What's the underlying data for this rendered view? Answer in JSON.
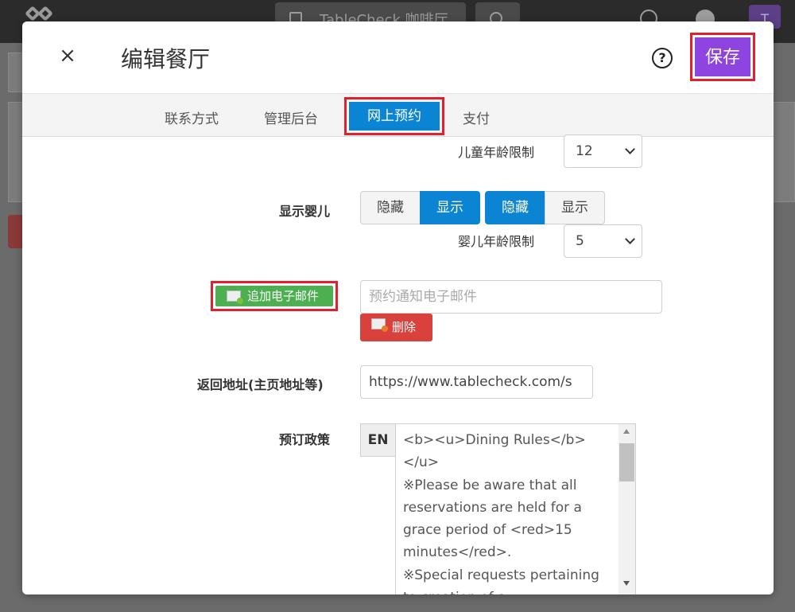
{
  "background": {
    "top_tab_label": "TableCheck 咖啡厅",
    "avatar_letter": "T"
  },
  "modal": {
    "title": "编辑餐厅",
    "close_label": "×",
    "help_label": "?",
    "save_label": "保存"
  },
  "tabs": [
    {
      "label": "联系方式"
    },
    {
      "label": "管理后台"
    },
    {
      "label": "网上预约",
      "active": true
    },
    {
      "label": "支付"
    }
  ],
  "form": {
    "child_age_label": "儿童年龄限制",
    "child_age_value": "12",
    "show_infant_label": "显示婴儿",
    "toggle_a": {
      "hide": "隐藏",
      "show": "显示",
      "selected": "show"
    },
    "toggle_b": {
      "hide": "隐藏",
      "show": "显示",
      "selected": "hide"
    },
    "infant_age_label": "婴儿年龄限制",
    "infant_age_value": "5",
    "add_email_label": "追加电子邮件",
    "email_placeholder": "预约通知电子邮件",
    "delete_label": "删除",
    "return_url_label": "返回地址(主页地址等)",
    "return_url_value": "https://www.tablecheck.com/s",
    "policy_label": "预订政策",
    "policy_lang": "EN",
    "policy_text": "<b><u>Dining Rules</b>\n</u>\n※Please be aware that all reservations are held for a grace period of <red>15 minutes</red>.\n※Special requests pertaining to creation of a"
  },
  "colors": {
    "accent": "#8e44e0",
    "primary": "#0b84d4",
    "success": "#4caf50",
    "danger": "#d9413c",
    "highlight": "#e0202e"
  }
}
